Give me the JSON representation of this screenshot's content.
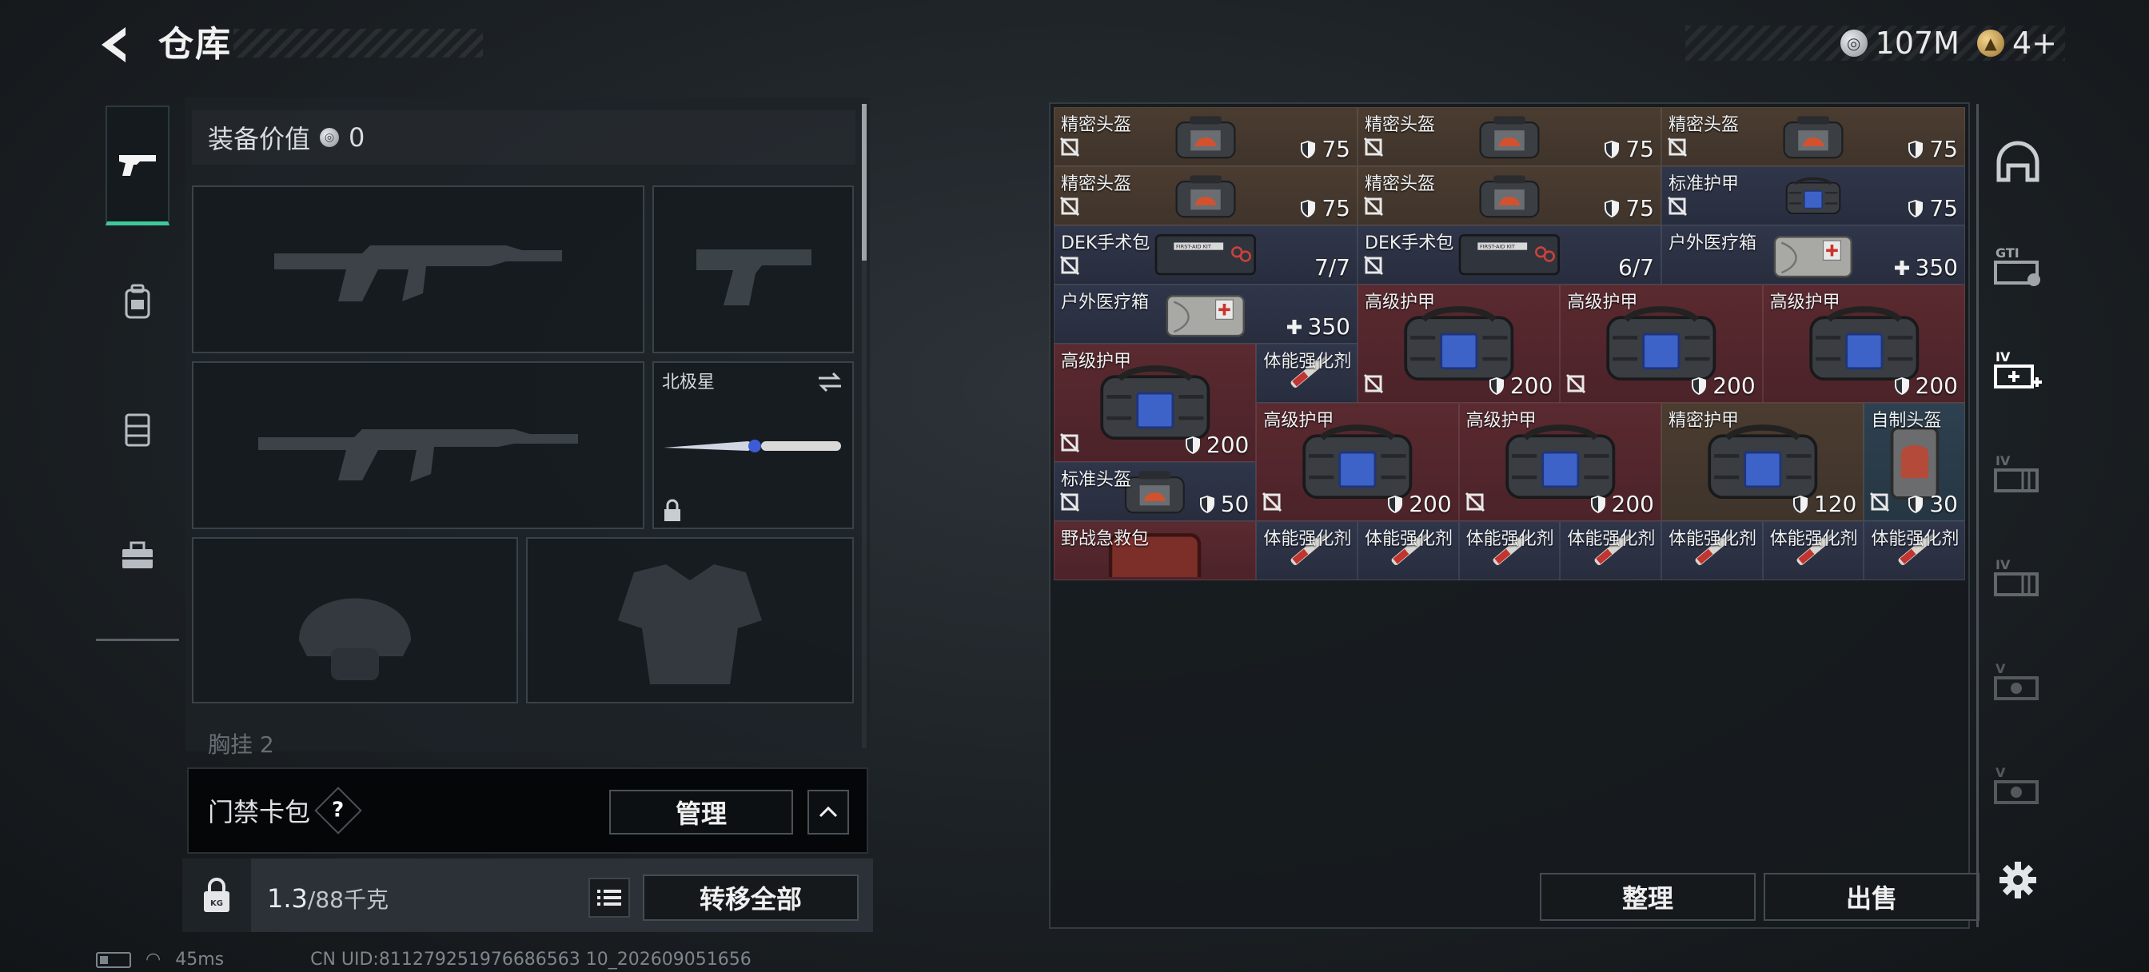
{
  "header": {
    "title": "仓库",
    "currencies": [
      {
        "icon": "silver-coin-icon",
        "amount": "107M"
      },
      {
        "icon": "gold-coin-icon",
        "amount": "4+"
      }
    ]
  },
  "left_tabs": [
    {
      "icon": "pistol-icon",
      "active": true
    },
    {
      "icon": "backpack-icon",
      "active": false
    },
    {
      "icon": "vest-rig-icon",
      "active": false
    },
    {
      "icon": "toolbox-icon",
      "active": false
    }
  ],
  "equipment": {
    "value_label": "装备价值",
    "value": "0",
    "melee_slot": {
      "label": "北极星"
    },
    "chest_label": "胸挂 2"
  },
  "keycard": {
    "title": "门禁卡包",
    "help": "?",
    "manage_label": "管理"
  },
  "bottom_left": {
    "weight_current": "1.3",
    "weight_max": "/88千克",
    "transfer_all_label": "转移全部"
  },
  "inventory": {
    "items": [
      {
        "name": "精密头盔",
        "value": "75",
        "value_icon": "shield-icon",
        "bg": "brown",
        "art": "helmet",
        "no_drop": true
      },
      {
        "name": "精密头盔",
        "value": "75",
        "value_icon": "shield-icon",
        "bg": "brown",
        "art": "helmet",
        "no_drop": true
      },
      {
        "name": "精密头盔",
        "value": "75",
        "value_icon": "shield-icon",
        "bg": "brown",
        "art": "helmet",
        "no_drop": true
      },
      {
        "name": "精密头盔",
        "value": "75",
        "value_icon": "shield-icon",
        "bg": "brown",
        "art": "helmet",
        "no_drop": true
      },
      {
        "name": "精密头盔",
        "value": "75",
        "value_icon": "shield-icon",
        "bg": "brown",
        "art": "helmet",
        "no_drop": true
      },
      {
        "name": "标准护甲",
        "value": "75",
        "value_icon": "shield-icon",
        "bg": "navy",
        "art": "armor",
        "no_drop": true
      },
      {
        "name": "DEK手术包",
        "value": "7/7",
        "value_icon": "",
        "bg": "navy",
        "art": "firstaid",
        "no_drop": true
      },
      {
        "name": "DEK手术包",
        "value": "6/7",
        "value_icon": "",
        "bg": "navy",
        "art": "firstaid",
        "no_drop": true
      },
      {
        "name": "户外医疗箱",
        "value": "350",
        "value_icon": "plus-icon",
        "bg": "navy",
        "art": "medbox",
        "no_drop": false
      },
      {
        "name": "户外医疗箱",
        "value": "350",
        "value_icon": "plus-icon",
        "bg": "navy",
        "art": "medbox",
        "no_drop": false
      },
      {
        "name": "高级护甲",
        "value": "200",
        "value_icon": "shield-icon",
        "bg": "red",
        "art": "armor",
        "no_drop": true
      },
      {
        "name": "高级护甲",
        "value": "200",
        "value_icon": "shield-icon",
        "bg": "red",
        "art": "armor",
        "no_drop": true
      },
      {
        "name": "高级护甲",
        "value": "200",
        "value_icon": "shield-icon",
        "bg": "red",
        "art": "armor",
        "no_drop": false
      },
      {
        "name": "高级护甲",
        "value": "200",
        "value_icon": "shield-icon",
        "bg": "red",
        "art": "armor",
        "no_drop": true
      },
      {
        "name": "体能强化剂",
        "value": "",
        "value_icon": "",
        "bg": "navy",
        "art": "syringe",
        "no_drop": false
      },
      {
        "name": "高级护甲",
        "value": "200",
        "value_icon": "shield-icon",
        "bg": "red",
        "art": "armor",
        "no_drop": true
      },
      {
        "name": "高级护甲",
        "value": "200",
        "value_icon": "shield-icon",
        "bg": "red",
        "art": "armor",
        "no_drop": true
      },
      {
        "name": "精密护甲",
        "value": "120",
        "value_icon": "shield-icon",
        "bg": "brown",
        "art": "armor",
        "no_drop": false
      },
      {
        "name": "自制头盔",
        "value": "30",
        "value_icon": "shield-icon",
        "bg": "slate",
        "art": "crudehelmet",
        "no_drop": true
      },
      {
        "name": "标准头盔",
        "value": "50",
        "value_icon": "shield-icon",
        "bg": "navy",
        "art": "helmet",
        "no_drop": true
      },
      {
        "name": "野战急救包",
        "value": "",
        "value_icon": "",
        "bg": "red",
        "art": "pouch",
        "no_drop": false
      },
      {
        "name": "体能强化剂",
        "value": "",
        "value_icon": "",
        "bg": "navy",
        "art": "syringe",
        "no_drop": false
      },
      {
        "name": "体能强化剂",
        "value": "",
        "value_icon": "",
        "bg": "navy",
        "art": "syringe",
        "no_drop": false
      },
      {
        "name": "体能强化剂",
        "value": "",
        "value_icon": "",
        "bg": "navy",
        "art": "syringe",
        "no_drop": false
      },
      {
        "name": "体能强化剂",
        "value": "",
        "value_icon": "",
        "bg": "navy",
        "art": "syringe",
        "no_drop": false
      },
      {
        "name": "体能强化剂",
        "value": "",
        "value_icon": "",
        "bg": "navy",
        "art": "syringe",
        "no_drop": false
      },
      {
        "name": "体能强化剂",
        "value": "",
        "value_icon": "",
        "bg": "navy",
        "art": "syringe",
        "no_drop": false
      },
      {
        "name": "体能强化剂",
        "value": "",
        "value_icon": "",
        "bg": "navy",
        "art": "syringe",
        "no_drop": false
      }
    ],
    "sort_label": "整理",
    "sell_label": "出售"
  },
  "right_rail": [
    {
      "icon": "helmet-tab-icon"
    },
    {
      "icon": "gti-crate-icon"
    },
    {
      "icon": "medical-crate-icon"
    },
    {
      "icon": "level-iv-crate-icon"
    },
    {
      "icon": "level-iv-crate-icon"
    },
    {
      "icon": "level-v-crate-icon"
    },
    {
      "icon": "level-v-crate-icon"
    },
    {
      "icon": "settings-gear-icon"
    }
  ],
  "status_bar": {
    "ping": "45ms",
    "uid": "CN UID:811279251976686563 10_202609051656"
  },
  "colors": {
    "accent_green": "#3fc89a",
    "cell_brown": "#4b3c30",
    "cell_navy": "#30364a",
    "cell_red": "#5a2a30",
    "cell_slate": "#2e4150"
  }
}
